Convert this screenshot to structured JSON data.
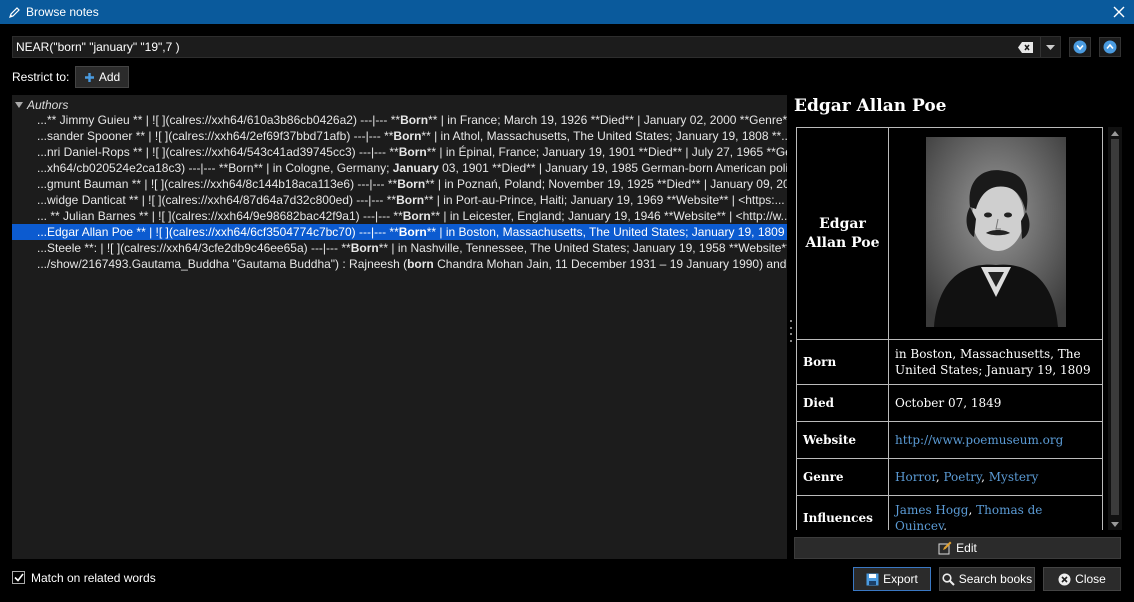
{
  "window": {
    "title": "Browse notes"
  },
  "search": {
    "query": "NEAR(\"born\" \"january\" \"19\",7 )"
  },
  "restrict": {
    "label": "Restrict to:",
    "add_label": "Add"
  },
  "tree": {
    "group": "Authors",
    "rows": [
      {
        "pre": "...** Jimmy Guieu ** | ![ ](calres://xxh64/610a3b86cb0426a2) ---|--- **",
        "bold": "Born",
        "post": "** | in France; March 19, 1926 **Died** | January 02, 2000 **Genre** ...",
        "selected": false
      },
      {
        "pre": "...sander Spooner ** | ![ ](calres://xxh64/2ef69f37bbd71afb) ---|--- **",
        "bold": "Born",
        "post": "** | in Athol, Massachusetts, The United States; January 19, 1808 **...",
        "selected": false
      },
      {
        "pre": "...nri Daniel-Rops ** | ![ ](calres://xxh64/543c41ad39745cc3) ---|--- **",
        "bold": "Born",
        "post": "** | in Épinal, France; January 19, 1901 **Died** | July 27, 1965 **Gen...",
        "selected": false
      },
      {
        "pre": "...xh64/cb020524e2ca18c3) ---|--- **Born** | in Cologne, Germany; ",
        "bold": "January",
        "post": " 03, 1901 **Died** | January 19, 1985 German-born American politi...",
        "selected": false
      },
      {
        "pre": "...gmunt Bauman ** | ![ ](calres://xxh64/8c144b18aca113e6) ---|--- **",
        "bold": "Born",
        "post": "** | in Poznań, Poland; November 19, 1925 **Died** | January 09, 20...",
        "selected": false
      },
      {
        "pre": "...widge Danticat ** | ![ ](calres://xxh64/87d64a7d32c800ed) ---|--- **",
        "bold": "Born",
        "post": "** | in Port-au-Prince, Haiti; January 19, 1969 **Website** | <https:...",
        "selected": false
      },
      {
        "pre": "... ** Julian Barnes ** | ![ ](calres://xxh64/9e98682bac42f9a1) ---|--- **",
        "bold": "Born",
        "post": "** | in Leicester, England; January 19, 1946 **Website** | <http://w...",
        "selected": false
      },
      {
        "pre": "...Edgar Allan Poe ** | ![ ](calres://xxh64/6cf3504774c7bc70) ---|--- **",
        "bold": "Born",
        "post": "** | in Boston, Massachusetts, The United States; January 19, 1809 *...",
        "selected": true
      },
      {
        "pre": "...Steele **: | ![ ](calres://xxh64/3cfe2db9c46ee65a) ---|--- **",
        "bold": "Born",
        "post": "** | in Nashville, Tennessee, The United States; January 19, 1958 **Website** ...",
        "selected": false
      },
      {
        "pre": ".../show/2167493.Gautama_Buddha \"Gautama Buddha\") : Rajneesh (",
        "bold": "born",
        "post": " Chandra Mohan Jain, 11 December 1931 – 19 January 1990) and lat...",
        "selected": false
      }
    ]
  },
  "preview": {
    "title": "Edgar Allan Poe",
    "name_line1": "Edgar",
    "name_line2": "Allan Poe",
    "born_label": "Born",
    "born_value": "in Boston, Massachusetts, The United States; January 19, 1809",
    "died_label": "Died",
    "died_value": "October 07, 1849",
    "website_label": "Website",
    "website_value": "http://www.poemuseum.org",
    "genre_label": "Genre",
    "genre_1": "Horror",
    "genre_sep1": ", ",
    "genre_2": "Poetry",
    "genre_sep2": ", ",
    "genre_3": "Mystery",
    "influences_label": "Influences",
    "influence_1": "James Hogg",
    "influence_sep": ", ",
    "influence_2": "Thomas de Quincey",
    "influence_tail": ","
  },
  "buttons": {
    "edit": "Edit",
    "match_related": "Match on related words",
    "export": "Export",
    "search_books": "Search books",
    "close": "Close"
  },
  "colors": {
    "titlebar": "#0a5a9c",
    "selection": "#0c5bd0",
    "link": "#5b9bd5"
  }
}
